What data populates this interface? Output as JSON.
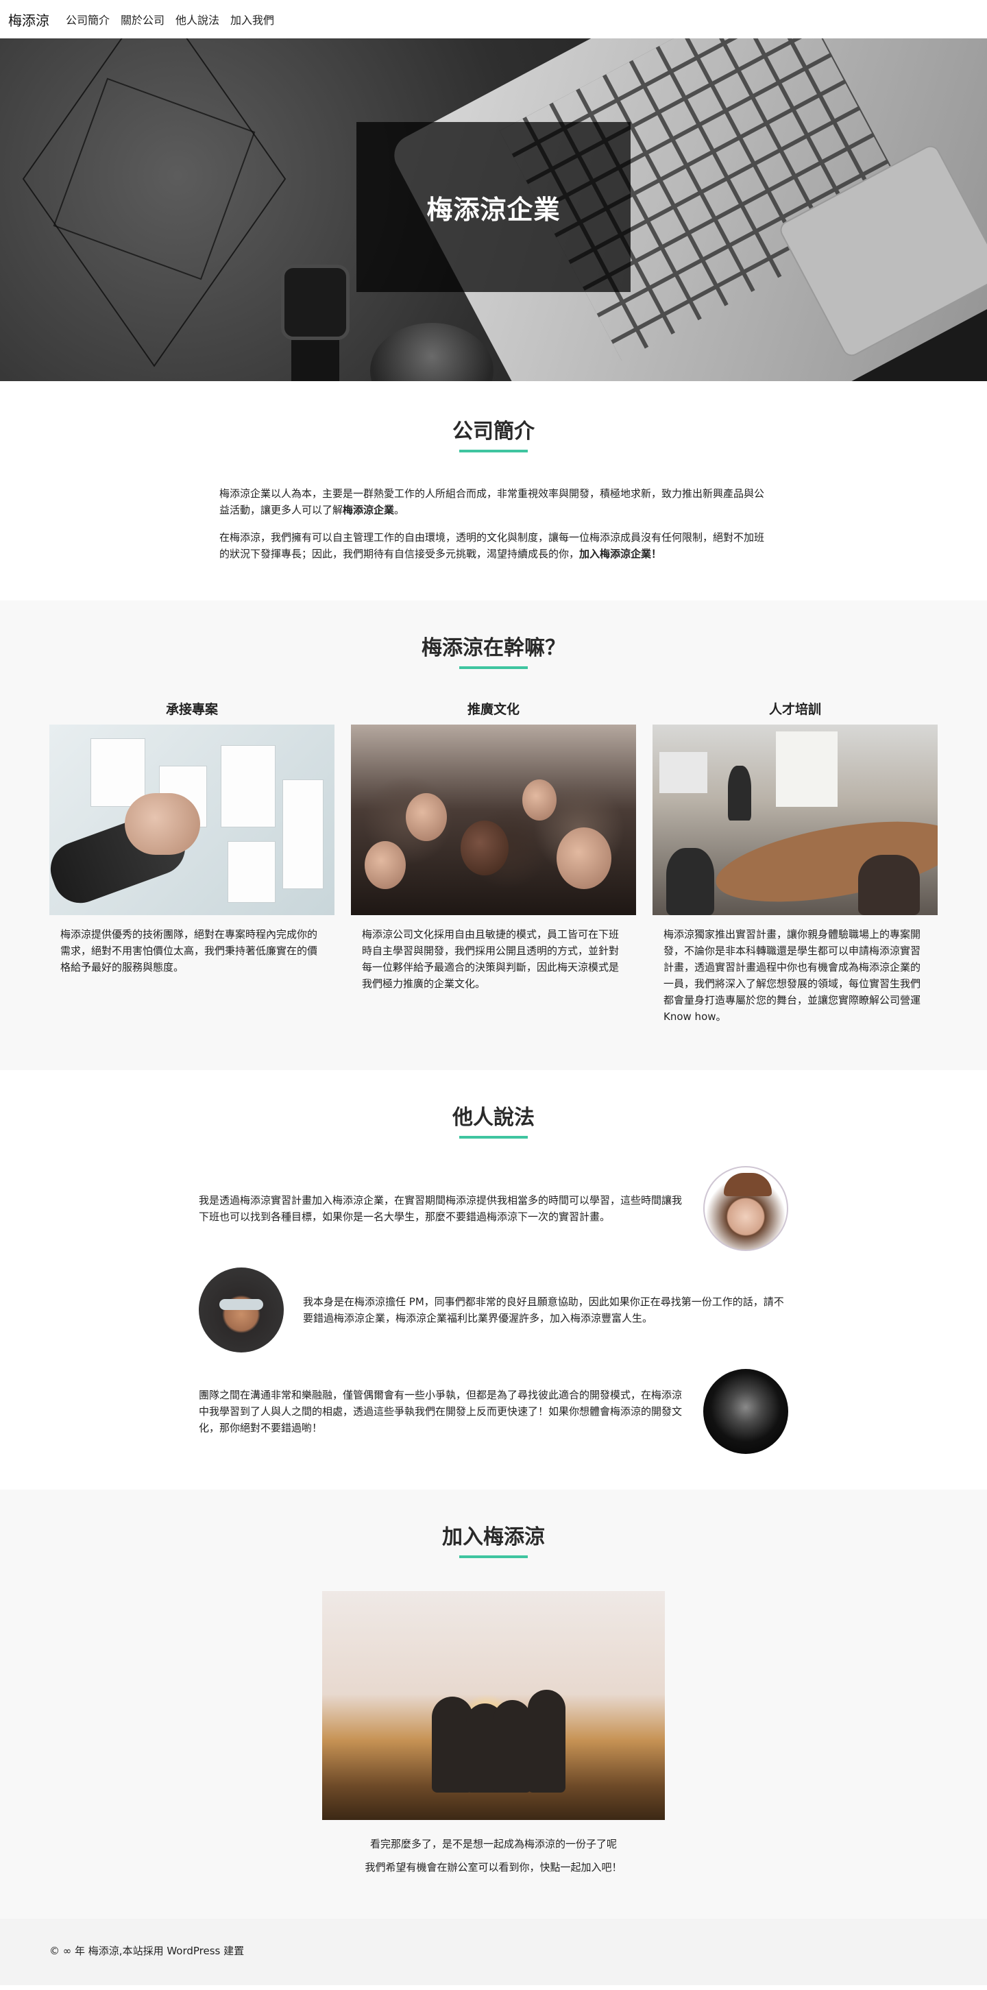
{
  "nav": {
    "brand": "梅添涼",
    "items": [
      "公司簡介",
      "關於公司",
      "他人說法",
      "加入我們"
    ]
  },
  "hero": {
    "title": "梅添涼企業"
  },
  "intro": {
    "title": "公司簡介",
    "p1_text": "梅添涼企業以人為本，主要是一群熱愛工作的人所組合而成，非常重視效率與開發，積極地求新，致力推出新興產品與公益活動，讓更多人可以了解",
    "p1_bold": "梅添涼企業",
    "p1_end": "。",
    "p2_text": "在梅添涼，我們擁有可以自主管理工作的自由環境，透明的文化與制度，讓每一位梅添涼成員沒有任何限制，絕對不加班的狀況下發揮專長；因此，我們期待有自信接受多元挑戰，渴望持續成長的你，",
    "p2_bold": "加入梅添涼企業！"
  },
  "services": {
    "title": "梅添涼在幹嘛？",
    "items": [
      {
        "title": "承接專案",
        "text": "梅添涼提供優秀的技術團隊，絕對在專案時程內完成你的需求，絕對不用害怕價位太高，我們秉持著低廉實在的價格給予最好的服務與態度。"
      },
      {
        "title": "推廣文化",
        "text": "梅添涼公司文化採用自由且敏捷的模式，員工皆可在下班時自主學習與開發，我們採用公開且透明的方式，並針對每一位夥伴給予最適合的決策與判斷，因此梅天涼模式是我們極力推廣的企業文化。"
      },
      {
        "title": "人才培訓",
        "text": "梅添涼獨家推出實習計畫，讓你親身體驗職場上的專案開發，不論你是非本科轉職還是學生都可以申請梅添涼實習計畫，透過實習計畫過程中你也有機會成為梅添涼企業的一員，我們將深入了解您想發展的領域，每位實習生我們都會量身打造專屬於您的舞台，並讓您實際瞭解公司營運 Know how。"
      }
    ]
  },
  "testimonials": {
    "title": "他人說法",
    "items": [
      {
        "text": "我是透過梅添涼實習計畫加入梅添涼企業，在實習期間梅添涼提供我相當多的時間可以學習，這些時間讓我下班也可以找到各種目標，如果你是一名大學生，那麼不要錯過梅添涼下一次的實習計畫。"
      },
      {
        "text": "我本身是在梅添涼擔任 PM，同事們都非常的良好且願意協助，因此如果你正在尋找第一份工作的話，請不要錯過梅添涼企業，梅添涼企業福利比業界優渥許多，加入梅添涼豐富人生。"
      },
      {
        "text": "團隊之間在溝通非常和樂融融，僅管偶爾會有一些小爭執，但都是為了尋找彼此適合的開發模式，在梅添涼中我學習到了人與人之間的相處，透過這些爭執我們在開發上反而更快速了！如果你想體會梅添涼的開發文化，那你絕對不要錯過喲！"
      }
    ]
  },
  "join": {
    "title": "加入梅添涼",
    "line1": "看完那麼多了，是不是想一起成為梅添涼的一份子了呢",
    "line2": "我們希望有機會在辦公室可以看到你，快點一起加入吧！"
  },
  "footer": {
    "text": "© ∞ 年 梅添涼,本站採用 WordPress 建置"
  },
  "colors": {
    "accent": "#3fc5a0"
  }
}
